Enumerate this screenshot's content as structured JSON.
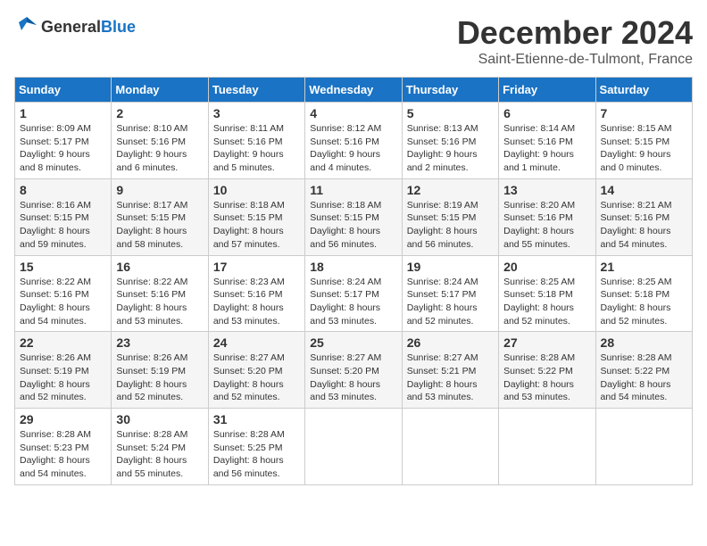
{
  "header": {
    "logo_line1": "General",
    "logo_line2": "Blue",
    "month": "December 2024",
    "location": "Saint-Etienne-de-Tulmont, France"
  },
  "weekdays": [
    "Sunday",
    "Monday",
    "Tuesday",
    "Wednesday",
    "Thursday",
    "Friday",
    "Saturday"
  ],
  "weeks": [
    [
      {
        "day": 1,
        "sunrise": "8:09 AM",
        "sunset": "5:17 PM",
        "daylight": "9 hours and 8 minutes."
      },
      {
        "day": 2,
        "sunrise": "8:10 AM",
        "sunset": "5:16 PM",
        "daylight": "9 hours and 6 minutes."
      },
      {
        "day": 3,
        "sunrise": "8:11 AM",
        "sunset": "5:16 PM",
        "daylight": "9 hours and 5 minutes."
      },
      {
        "day": 4,
        "sunrise": "8:12 AM",
        "sunset": "5:16 PM",
        "daylight": "9 hours and 4 minutes."
      },
      {
        "day": 5,
        "sunrise": "8:13 AM",
        "sunset": "5:16 PM",
        "daylight": "9 hours and 2 minutes."
      },
      {
        "day": 6,
        "sunrise": "8:14 AM",
        "sunset": "5:16 PM",
        "daylight": "9 hours and 1 minute."
      },
      {
        "day": 7,
        "sunrise": "8:15 AM",
        "sunset": "5:15 PM",
        "daylight": "9 hours and 0 minutes."
      }
    ],
    [
      {
        "day": 8,
        "sunrise": "8:16 AM",
        "sunset": "5:15 PM",
        "daylight": "8 hours and 59 minutes."
      },
      {
        "day": 9,
        "sunrise": "8:17 AM",
        "sunset": "5:15 PM",
        "daylight": "8 hours and 58 minutes."
      },
      {
        "day": 10,
        "sunrise": "8:18 AM",
        "sunset": "5:15 PM",
        "daylight": "8 hours and 57 minutes."
      },
      {
        "day": 11,
        "sunrise": "8:18 AM",
        "sunset": "5:15 PM",
        "daylight": "8 hours and 56 minutes."
      },
      {
        "day": 12,
        "sunrise": "8:19 AM",
        "sunset": "5:15 PM",
        "daylight": "8 hours and 56 minutes."
      },
      {
        "day": 13,
        "sunrise": "8:20 AM",
        "sunset": "5:16 PM",
        "daylight": "8 hours and 55 minutes."
      },
      {
        "day": 14,
        "sunrise": "8:21 AM",
        "sunset": "5:16 PM",
        "daylight": "8 hours and 54 minutes."
      }
    ],
    [
      {
        "day": 15,
        "sunrise": "8:22 AM",
        "sunset": "5:16 PM",
        "daylight": "8 hours and 54 minutes."
      },
      {
        "day": 16,
        "sunrise": "8:22 AM",
        "sunset": "5:16 PM",
        "daylight": "8 hours and 53 minutes."
      },
      {
        "day": 17,
        "sunrise": "8:23 AM",
        "sunset": "5:16 PM",
        "daylight": "8 hours and 53 minutes."
      },
      {
        "day": 18,
        "sunrise": "8:24 AM",
        "sunset": "5:17 PM",
        "daylight": "8 hours and 53 minutes."
      },
      {
        "day": 19,
        "sunrise": "8:24 AM",
        "sunset": "5:17 PM",
        "daylight": "8 hours and 52 minutes."
      },
      {
        "day": 20,
        "sunrise": "8:25 AM",
        "sunset": "5:18 PM",
        "daylight": "8 hours and 52 minutes."
      },
      {
        "day": 21,
        "sunrise": "8:25 AM",
        "sunset": "5:18 PM",
        "daylight": "8 hours and 52 minutes."
      }
    ],
    [
      {
        "day": 22,
        "sunrise": "8:26 AM",
        "sunset": "5:19 PM",
        "daylight": "8 hours and 52 minutes."
      },
      {
        "day": 23,
        "sunrise": "8:26 AM",
        "sunset": "5:19 PM",
        "daylight": "8 hours and 52 minutes."
      },
      {
        "day": 24,
        "sunrise": "8:27 AM",
        "sunset": "5:20 PM",
        "daylight": "8 hours and 52 minutes."
      },
      {
        "day": 25,
        "sunrise": "8:27 AM",
        "sunset": "5:20 PM",
        "daylight": "8 hours and 53 minutes."
      },
      {
        "day": 26,
        "sunrise": "8:27 AM",
        "sunset": "5:21 PM",
        "daylight": "8 hours and 53 minutes."
      },
      {
        "day": 27,
        "sunrise": "8:28 AM",
        "sunset": "5:22 PM",
        "daylight": "8 hours and 53 minutes."
      },
      {
        "day": 28,
        "sunrise": "8:28 AM",
        "sunset": "5:22 PM",
        "daylight": "8 hours and 54 minutes."
      }
    ],
    [
      {
        "day": 29,
        "sunrise": "8:28 AM",
        "sunset": "5:23 PM",
        "daylight": "8 hours and 54 minutes."
      },
      {
        "day": 30,
        "sunrise": "8:28 AM",
        "sunset": "5:24 PM",
        "daylight": "8 hours and 55 minutes."
      },
      {
        "day": 31,
        "sunrise": "8:28 AM",
        "sunset": "5:25 PM",
        "daylight": "8 hours and 56 minutes."
      },
      null,
      null,
      null,
      null
    ]
  ]
}
